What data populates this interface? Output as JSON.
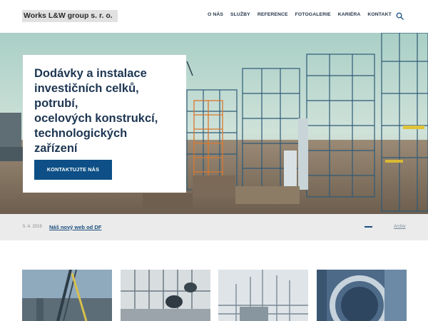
{
  "header": {
    "logo_text": "Works L&W group s. r. o.",
    "nav": [
      "O NÁS",
      "SLUŽBY",
      "REFERENCE",
      "FOTOGALERIE",
      "KARIÉRA",
      "KONTAKT"
    ],
    "search_icon": "search-icon"
  },
  "hero": {
    "title_lines": [
      "Dodávky a instalace",
      "investičních celků,",
      "potrubí,",
      "ocelových konstrukcí,",
      "technologických",
      "zařízení"
    ],
    "cta_label": "KONTAKTUJTE NÁS"
  },
  "news": {
    "date": "5. 4. 2019",
    "headline": "Náš nový web od DF",
    "archive_label": "Archiv"
  },
  "colors": {
    "brand_blue": "#0d4f86",
    "heading": "#1d3652",
    "strip_bg": "#ebebeb"
  }
}
